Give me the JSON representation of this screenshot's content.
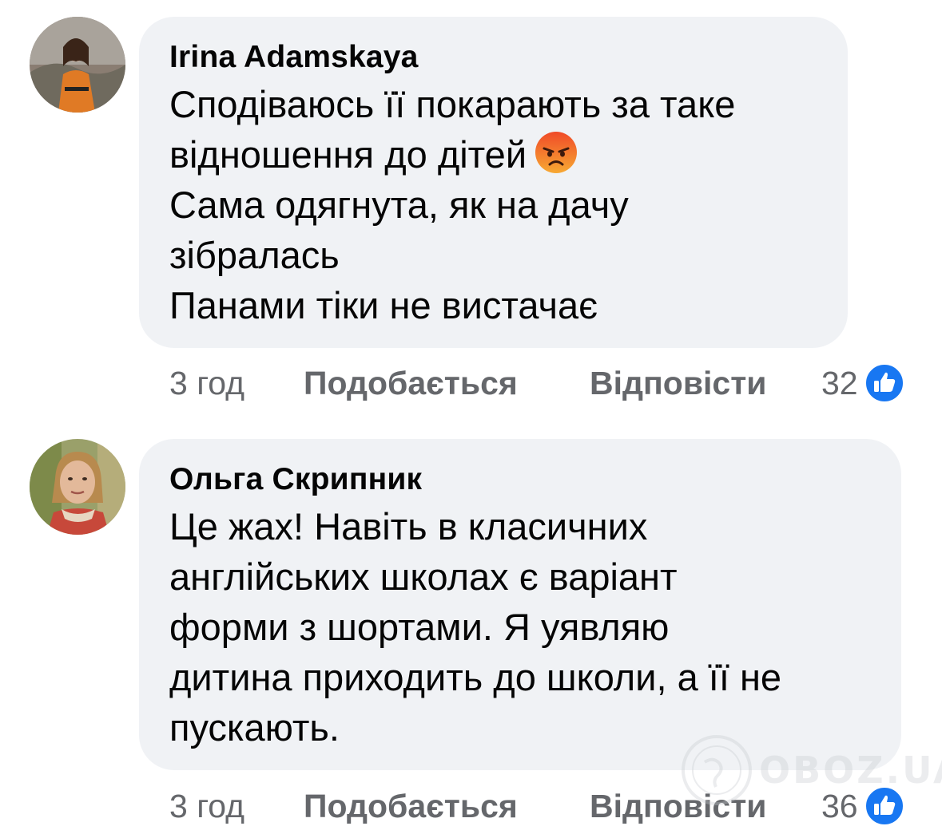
{
  "comments": [
    {
      "author": "Irina Adamskaya",
      "lines": [
        "Сподіваюсь її покарають за таке",
        "відношення до дітей",
        "Сама одягнута, як на дачу",
        "зібралась",
        "Панами тіки не вистачає"
      ],
      "emoji": "angry-face-emoji",
      "time": "3 год",
      "like_label": "Подобається",
      "reply_label": "Відповісти",
      "reaction_count": "32",
      "reaction_icon": "like-icon"
    },
    {
      "author": "Ольга Скрипник",
      "lines": [
        "Це жах! Навіть в класичних",
        "англійських школах є варіант",
        "форми з шортами.  Я уявляю",
        "дитина приходить до школи, а її не",
        "пускають."
      ],
      "time": "3 год",
      "like_label": "Подобається",
      "reply_label": "Відповісти",
      "reaction_count": "36",
      "reaction_icon": "like-icon"
    }
  ],
  "watermark": {
    "text": "OBOZ.UA"
  },
  "colors": {
    "bubble": "#f0f2f5",
    "text": "#050505",
    "secondary": "#65676b",
    "like_blue": "#1877f2"
  }
}
